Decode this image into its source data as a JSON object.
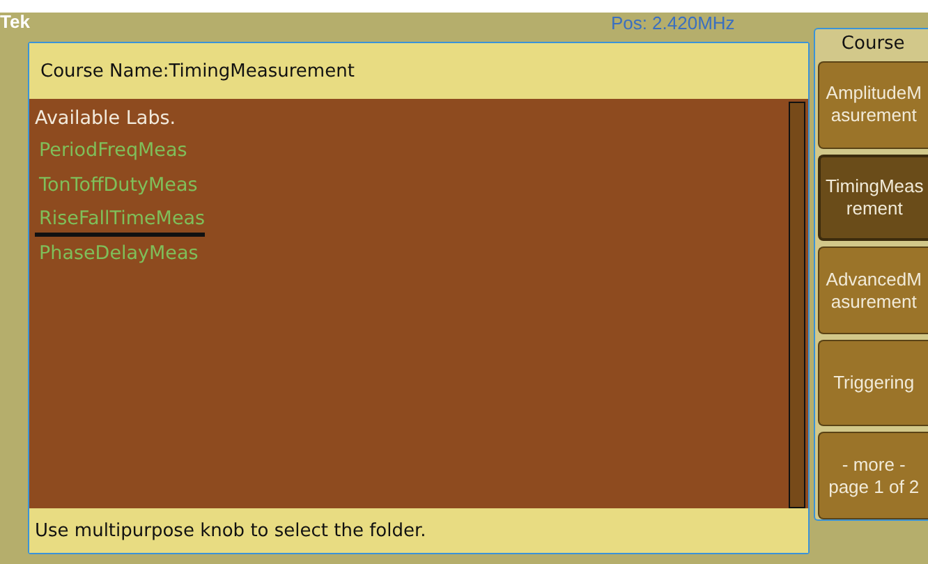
{
  "brand": "Tek",
  "position": "Pos: 2.420MHz",
  "course_name": "Course Name:TimingMeasurement",
  "list": {
    "heading": "Available Labs.",
    "items": [
      {
        "label": "PeriodFreqMeas",
        "selected": false
      },
      {
        "label": "TonToffDutyMeas",
        "selected": false
      },
      {
        "label": "RiseFallTimeMeas",
        "selected": true
      },
      {
        "label": "PhaseDelayMeas",
        "selected": false
      }
    ]
  },
  "status": "Use multipurpose knob to select the folder.",
  "side_menu": {
    "title": "Course",
    "buttons": [
      {
        "lines": [
          "AmplitudeM",
          "asurement"
        ],
        "selected": false
      },
      {
        "lines": [
          "TimingMeas",
          "rement"
        ],
        "selected": true
      },
      {
        "lines": [
          "AdvancedM",
          "asurement"
        ],
        "selected": false
      },
      {
        "lines": [
          "Triggering"
        ],
        "selected": false
      },
      {
        "lines": [
          "- more -",
          "page 1 of 2"
        ],
        "selected": false
      }
    ]
  }
}
